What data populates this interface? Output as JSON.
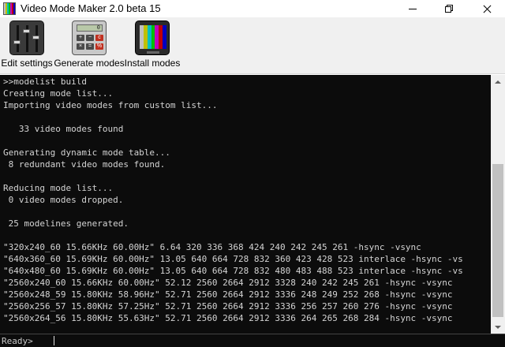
{
  "window": {
    "title": "Video Mode Maker 2.0 beta 15",
    "app_icon": "color-bars-icon",
    "controls": [
      "minimize-icon",
      "restore-icon",
      "close-icon"
    ]
  },
  "toolbar": {
    "buttons": [
      {
        "label": "Edit settings",
        "icon": "mixer-sliders-icon"
      },
      {
        "label": "Generate modes",
        "icon": "calculator-icon",
        "display": "0"
      },
      {
        "label": "Install modes",
        "icon": "tv-color-bars-icon"
      }
    ]
  },
  "console": {
    "lines": [
      ">>modelist build",
      "Creating mode list...",
      "Importing video modes from custom list...",
      "",
      "   33 video modes found",
      "",
      "Generating dynamic mode table...",
      " 8 redundant video modes found.",
      "",
      "Reducing mode list...",
      " 0 video modes dropped.",
      "",
      " 25 modelines generated.",
      "",
      "\"320x240_60 15.66KHz 60.00Hz\" 6.64 320 336 368 424 240 242 245 261 -hsync -vsync",
      "\"640x360_60 15.69KHz 60.00Hz\" 13.05 640 664 728 832 360 423 428 523 interlace -hsync -vs",
      "\"640x480_60 15.69KHz 60.00Hz\" 13.05 640 664 728 832 480 483 488 523 interlace -hsync -vs",
      "\"2560x240_60 15.66KHz 60.00Hz\" 52.12 2560 2664 2912 3328 240 242 245 261 -hsync -vsync",
      "\"2560x248_59 15.80KHz 58.96Hz\" 52.71 2560 2664 2912 3336 248 249 252 268 -hsync -vsync",
      "\"2560x256_57 15.80KHz 57.25Hz\" 52.71 2560 2664 2912 3336 256 257 260 276 -hsync -vsync",
      "\"2560x264_56 15.80KHz 55.63Hz\" 52.71 2560 2664 2912 3336 264 265 268 284 -hsync -vsync"
    ]
  },
  "input": {
    "prompt": "Ready>",
    "value": ""
  },
  "colors": {
    "console_bg": "#0c0c0c",
    "console_fg": "#d4d4d4",
    "toolbar_bg": "#f0f0f0"
  }
}
